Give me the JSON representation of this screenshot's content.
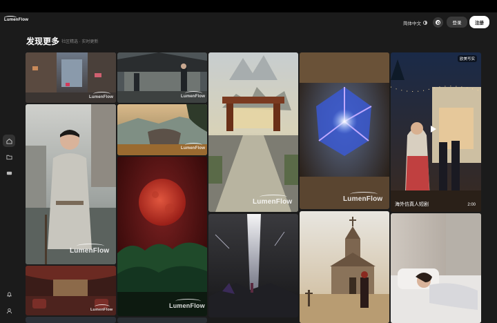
{
  "app": {
    "logo_text": "LumenFlow"
  },
  "header": {
    "language_label": "简体中文",
    "login_label": "登录",
    "register_label": "注册"
  },
  "page": {
    "title": "发现更多",
    "subtitle": "社区精选 · 实时更新"
  },
  "sidebar": {
    "items": [
      {
        "icon": "home-icon"
      },
      {
        "icon": "folder-icon"
      },
      {
        "icon": "drive-icon"
      }
    ],
    "bottom": [
      {
        "icon": "bell-icon"
      },
      {
        "icon": "user-icon"
      }
    ]
  },
  "gallery": {
    "watermark": "LumenFlow",
    "tiles": [
      {
        "id": "t1",
        "subject": "rainy old street alley"
      },
      {
        "id": "t2",
        "subject": "ancient courtyard figures"
      },
      {
        "id": "t3",
        "subject": "fantasy temple gate"
      },
      {
        "id": "t4",
        "subject": "glowing crystal cube"
      },
      {
        "id": "t5",
        "subject": "night party terrace video",
        "badge": "欧美写实",
        "video_title": "海外仿真人短剧",
        "duration": "2:00"
      },
      {
        "id": "t6",
        "subject": "young man in robe"
      },
      {
        "id": "t7",
        "subject": "mountain rock landscape"
      },
      {
        "id": "t8",
        "subject": "blood red moon"
      },
      {
        "id": "t9",
        "subject": "light beam storm"
      },
      {
        "id": "t10",
        "subject": "desert chapel"
      },
      {
        "id": "t11",
        "subject": "woman sleeping in bed"
      },
      {
        "id": "t12",
        "subject": "theater stage interior"
      }
    ]
  },
  "colors": {
    "background": "#1b1b1b",
    "topbar": "#000000",
    "button_dark": "#3a3a3a",
    "button_light": "#ffffff"
  }
}
